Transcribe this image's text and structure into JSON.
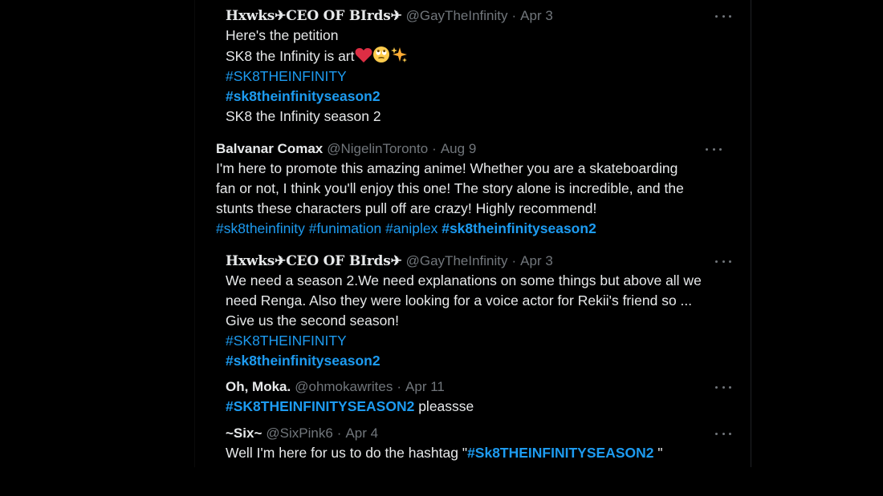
{
  "tweets": [
    {
      "name": "Hxwks✈CEO OF BIrds✈",
      "handle": "@GayTheInfinity",
      "date": "Apr 3",
      "lines": [
        "Here's the petition",
        "SK8 the Infinity is art"
      ],
      "tag1": "#SK8THEINFINITY",
      "tag2": "#sk8theinfinityseason2",
      "last": "SK8 the Infinity season 2",
      "emojis": [
        "red-heart",
        "face-with-rolling-eyes",
        "sparkles"
      ]
    },
    {
      "name": "Balvanar Comax",
      "handle": "@NigelinToronto",
      "date": "Aug 9",
      "lines": [
        "I'm here to promote this amazing anime! Whether you are a skateboarding",
        "fan or not, I think you'll enjoy this one! The story alone is incredible, and the",
        "stunts these characters pull off are crazy! Highly recommend!"
      ],
      "tags": [
        "#sk8theinfinity",
        "#funimation",
        "#aniplex",
        "#sk8theinfinityseason2"
      ]
    },
    {
      "name": "Hxwks✈CEO OF BIrds✈",
      "handle": "@GayTheInfinity",
      "date": "Apr 3",
      "lines": [
        "We need a season 2.We need explanations on some things but above all we",
        "need Renga. Also they were looking for a voice actor for Rekii's friend so ...",
        "Give us the second season!"
      ],
      "tag1": "#SK8THEINFINITY",
      "tag2": "#sk8theinfinityseason2"
    },
    {
      "name": "Oh, Moka.",
      "handle": "@ohmokawrites",
      "date": "Apr 11",
      "tag": "#SK8THEINFINITYSEASON2",
      "text": "pleassse"
    },
    {
      "name": "~Six~",
      "handle": "@SixPink6",
      "date": "Apr 4",
      "text_before": "Well I'm here for us to do the hashtag \"",
      "tag": "#Sk8THEINFINITYSEASON2",
      "text_after": " \""
    }
  ],
  "colors": {
    "background": "#000000",
    "text": "#e7e9ea",
    "muted": "#71767b",
    "link": "#1d9bf0"
  },
  "icons": {
    "more": "more-horizontal-icon"
  }
}
